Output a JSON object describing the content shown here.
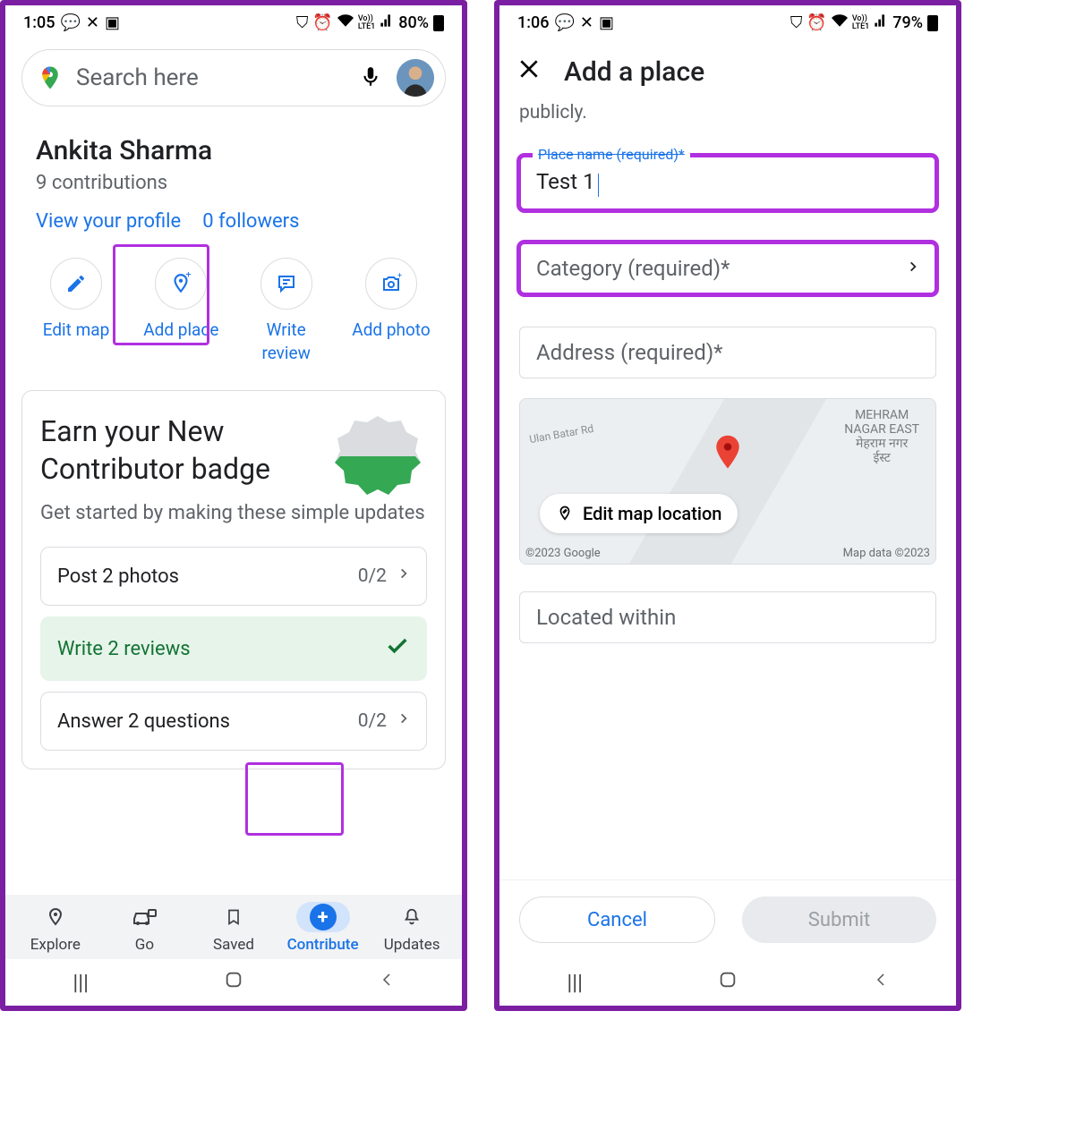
{
  "phone1": {
    "status": {
      "time": "1:05",
      "battery": "80%"
    },
    "search": {
      "placeholder": "Search here"
    },
    "profile": {
      "name": "Ankita Sharma",
      "contributions": "9 contributions",
      "view_profile": "View your profile",
      "followers": "0 followers"
    },
    "actions": {
      "edit_map": "Edit map",
      "add_place": "Add place",
      "write_review": "Write review",
      "add_photo": "Add photo"
    },
    "card": {
      "title": "Earn your New Contributor badge",
      "subtitle": "Get started by making these simple updates",
      "tasks": [
        {
          "label": "Post 2 photos",
          "progress": "0/2",
          "done": false
        },
        {
          "label": "Write 2 reviews",
          "progress": "",
          "done": true
        },
        {
          "label": "Answer 2 questions",
          "progress": "0/2",
          "done": false
        }
      ]
    },
    "nav": {
      "explore": "Explore",
      "go": "Go",
      "saved": "Saved",
      "contribute": "Contribute",
      "updates": "Updates"
    }
  },
  "phone2": {
    "status": {
      "time": "1:06",
      "battery": "79%"
    },
    "header": {
      "title": "Add a place"
    },
    "help_fragment": "publicly.",
    "fields": {
      "name_label": "Place name (required)*",
      "name_value": "Test 1",
      "category_placeholder": "Category (required)*",
      "address_placeholder": "Address (required)*",
      "located_placeholder": "Located within"
    },
    "map": {
      "edit_label": "Edit map location",
      "road": "Ulan Batar Rd",
      "area_line1": "MEHRAM",
      "area_line2": "NAGAR EAST",
      "area_line3": "मेहराम नगर",
      "area_line4": "ईस्ट",
      "copyright": "©2023 Google",
      "data": "Map data ©2023"
    },
    "buttons": {
      "cancel": "Cancel",
      "submit": "Submit"
    }
  }
}
